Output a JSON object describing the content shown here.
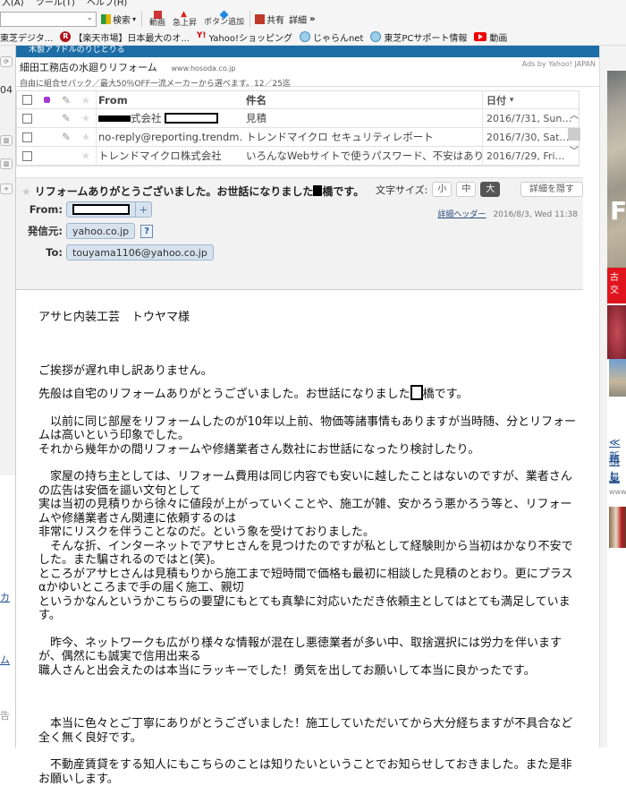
{
  "browser": {
    "menu": [
      "入(A)",
      "ツール(T)",
      "ヘルプ(H)"
    ],
    "toolbar": {
      "search_label": "検索",
      "video_label": "動画",
      "rising_label": "急上昇",
      "add_button_label": "ボタン追加",
      "share_label": "共有",
      "details_label": "詳細",
      "more_label": "»"
    },
    "favorites": [
      {
        "label": "東芝デジタ...",
        "icon": "page-icon"
      },
      {
        "label": "【楽天市場】日本最大のオ...",
        "icon": "rakuten-icon"
      },
      {
        "label": "Yahoo!ショッピング",
        "icon": "yahoo-icon"
      },
      {
        "label": "じゃらんnet",
        "icon": "ie-icon"
      },
      {
        "label": "東芝PCサポート情報",
        "icon": "ie-icon"
      },
      {
        "label": "動画",
        "icon": "youtube-icon"
      }
    ]
  },
  "left_strip": {
    "count_text": "04",
    "bottom_chars": [
      "カ",
      "ム",
      "告"
    ]
  },
  "banner_text": "木製ア  7ドルのりじとりる",
  "ad": {
    "title": "細田工務店の水廻りリフォーム",
    "url": "www.hosoda.co.jp",
    "by": "Ads by Yahoo! JAPAN",
    "description": "自由に組合せパック／最大50％OFF一流メーカーから選べます。12／25迄"
  },
  "mail_list": {
    "headers": {
      "from": "From",
      "subject": "件名",
      "date": "日付",
      "sort_arrow": "▾"
    },
    "rows": [
      {
        "from_suffix": "式会社",
        "subject": "見積",
        "date": "2016/7/31, Sun…",
        "attachment": true,
        "redacted": true
      },
      {
        "from": "no-reply@reporting.trendm…",
        "subject": "トレンドマイクロ セキュリティレポート",
        "date": "2016/7/30, Sat…",
        "attachment": true
      },
      {
        "from": "トレンドマイクロ株式会社",
        "subject": "いろんなWebサイトで使うパスワード、不安はありま…",
        "date": "2016/7/29, Fri…",
        "attachment": false
      }
    ]
  },
  "message": {
    "subject_pre": "リフォームありがとうございました。お世話になりました",
    "subject_post": "橋です。",
    "font_size_label": "文字サイズ:",
    "font_sizes": [
      "小",
      "中",
      "大"
    ],
    "font_size_selected": "大",
    "hide_details": "詳細を隠す",
    "detail_header_link": "詳細ヘッダー",
    "datetime": "2016/8/3, Wed 11:38",
    "from_label": "From:",
    "sender_domain_label": "発信元:",
    "sender_domain": "yahoo.co.jp",
    "to_label": "To:",
    "to": "touyama1106@yahoo.co.jp",
    "help_icon": "?"
  },
  "body": {
    "greeting": "アサヒ内装工芸　トウヤマ様",
    "p1": "ご挨拶が遅れ申し訳ありません。",
    "p2_pre": "先般は自宅のリフォームありがとうございました。お世話になりました",
    "p2_post": "橋です。",
    "p3": "　以前に同じ部屋をリフォームしたのが10年以上前、物価等諸事情もありますが当時随、分とリフォームは高いという印象でした。",
    "p3b": "それから幾年かの間リフォームや修繕業者さん数社にお世話になったり検討したり。",
    "p4": "　家屋の持ち主としては、リフォーム費用は同じ内容でも安いに越したことはないのですが、業者さんの広告は安価を謳い文句として",
    "p4b": "実は当初の見積りから徐々に値段が上がっていくことや、施工が雑、安かろう悪かろう等と、リフォームや修繕業者さん関連に依頼するのは",
    "p4c": "非常にリスクを伴うことなのだ。という象を受けておりました。",
    "p4d": "　そんな折、インターネットでアサヒさんを見つけたのですが私として経験則から当初はかなり不安でした。また騙されるのではと(笑)。",
    "p4e": "ところがアサヒさんは見積もりから施工まで短時間で価格も最初に相談した見積のとおり。更にプラスαかゆいところまで手の届く施工、親切",
    "p4f": "というかなんというかこちらの要望にもとても真摯に対応いただき依頼主としてはとても満足しています。",
    "p5": "　昨今、ネットワークも広がり様々な情報が混在し悪徳業者が多い中、取捨選択には労力を伴いますが、偶然にも誠実で信用出来る",
    "p5b": "職人さんと出会えたのは本当にラッキーでした！勇気を出してお願いして本当に良かったです。",
    "p6": "　本当に色々とご丁寧にありがとうございました！施工していただいてから大分経ちますが不具合など全く無く良好です。",
    "p7": "　不動産賃貸をする知人にもこちらのことは知りたいということでお知らせしておきました。また是非お願いします。"
  },
  "right_ads": {
    "big_letter": "F",
    "red_band": "古\n交",
    "link_lines": [
      "≪新",
      "積し",
      "量"
    ],
    "url_text": "www"
  }
}
